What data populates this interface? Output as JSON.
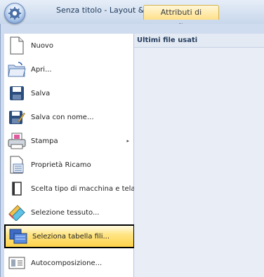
{
  "window": {
    "title": "Senza titolo - Layout & Editing",
    "tab": "Attributi di cucitura"
  },
  "recent": {
    "header": "Ultimi file usati"
  },
  "menu": {
    "items": [
      {
        "label": "Nuovo",
        "icon": "new-file-icon"
      },
      {
        "label": "Apri...",
        "icon": "open-folder-icon"
      },
      {
        "label": "Salva",
        "icon": "save-disk-icon"
      },
      {
        "label": "Salva con nome...",
        "icon": "save-as-icon"
      },
      {
        "label": "Stampa",
        "icon": "printer-icon",
        "submenu_arrow": "▸"
      },
      {
        "label": "Proprietà Ricamo",
        "icon": "embroidery-properties-icon"
      },
      {
        "label": "Scelta tipo di macchina e telaio...",
        "icon": "hoop-icon"
      },
      {
        "label": "Selezione tessuto...",
        "icon": "fabric-icon"
      },
      {
        "label": "Seleziona tabella fili...",
        "icon": "thread-table-icon",
        "selected": true
      },
      {
        "label": "Autocomposizione...",
        "icon": "wizard-icon"
      }
    ]
  }
}
